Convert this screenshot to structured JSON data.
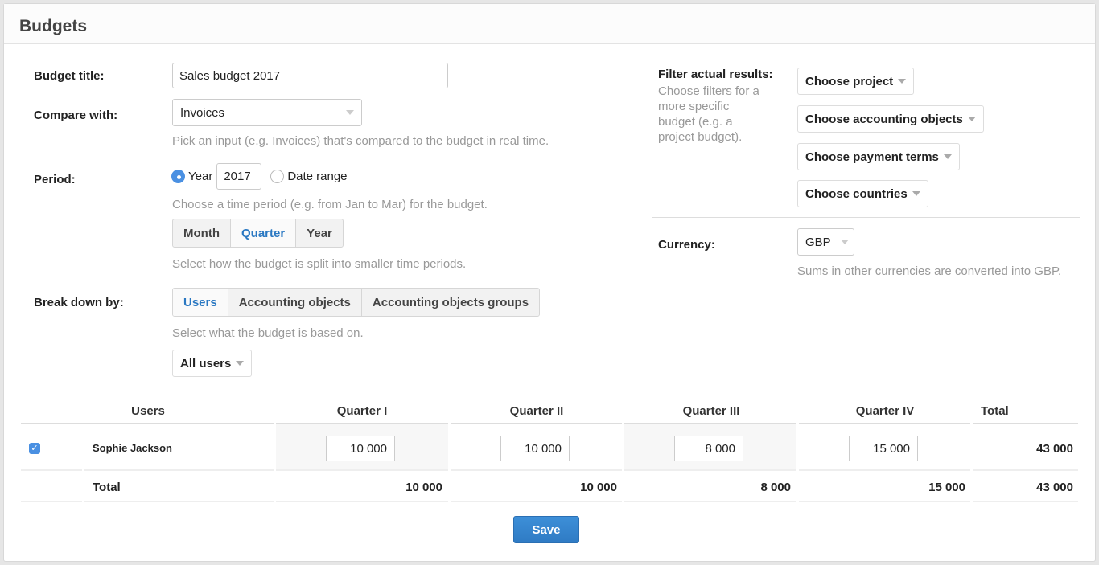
{
  "page": {
    "title": "Budgets"
  },
  "form": {
    "budget_title": {
      "label": "Budget title:",
      "value": "Sales budget 2017"
    },
    "compare_with": {
      "label": "Compare with:",
      "value": "Invoices",
      "help": "Pick an input (e.g. Invoices) that's compared to the budget in real time."
    },
    "period": {
      "label": "Period:",
      "option_year": "Year",
      "year_value": "2017",
      "option_date_range": "Date range",
      "selected": "Year",
      "help": "Choose a time period (e.g. from Jan to Mar) for the budget.",
      "split_options": [
        "Month",
        "Quarter",
        "Year"
      ],
      "split_selected": "Quarter",
      "split_help": "Select how the budget is split into smaller time periods."
    },
    "break_down": {
      "label": "Break down by:",
      "options": [
        "Users",
        "Accounting objects",
        "Accounting objects groups"
      ],
      "selected": "Users",
      "help": "Select what the budget is based on.",
      "users_filter": "All users"
    }
  },
  "filters": {
    "label": "Filter actual results:",
    "help": "Choose filters for a more specific budget (e.g. a project budget).",
    "buttons": [
      "Choose project",
      "Choose accounting objects",
      "Choose payment terms",
      "Choose countries"
    ]
  },
  "currency": {
    "label": "Currency:",
    "value": "GBP",
    "help": "Sums in other currencies are converted into GBP."
  },
  "table": {
    "headers": [
      "Users",
      "Quarter I",
      "Quarter II",
      "Quarter III",
      "Quarter IV",
      "Total"
    ],
    "rows": [
      {
        "checked": true,
        "name": "Sophie Jackson",
        "values": [
          "10 000",
          "10 000",
          "8 000",
          "15 000"
        ],
        "total": "43 000"
      }
    ],
    "total_row": {
      "label": "Total",
      "values": [
        "10 000",
        "10 000",
        "8 000",
        "15 000"
      ],
      "total": "43 000"
    }
  },
  "actions": {
    "save_label": "Save"
  },
  "colors": {
    "accent": "#2a78c2",
    "primary_button": "#3d8fd8",
    "checkbox": "#4a90e2"
  }
}
